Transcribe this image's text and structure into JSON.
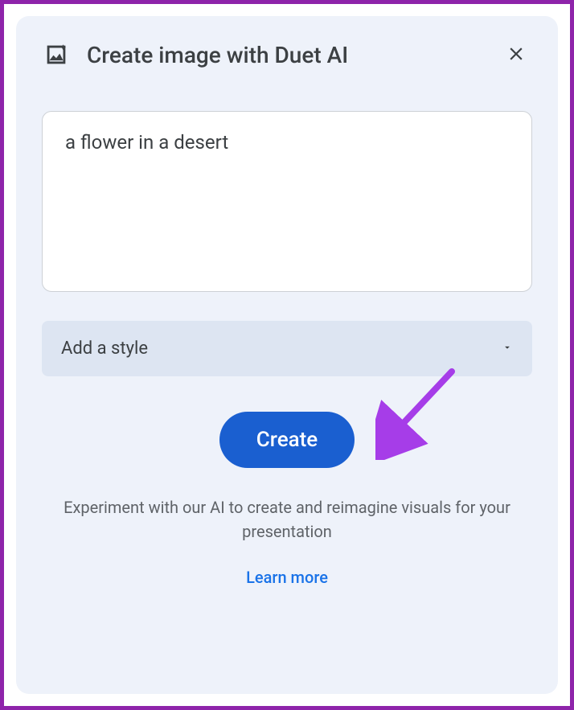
{
  "header": {
    "title": "Create image with Duet AI"
  },
  "prompt": {
    "value": "a flower in a desert"
  },
  "styleDropdown": {
    "label": "Add a style"
  },
  "createButton": {
    "label": "Create"
  },
  "experimentText": "Experiment with our AI to create and reimagine visuals for your presentation",
  "learnMore": {
    "label": "Learn more"
  },
  "annotation": {
    "arrowColor": "#a63de8"
  }
}
